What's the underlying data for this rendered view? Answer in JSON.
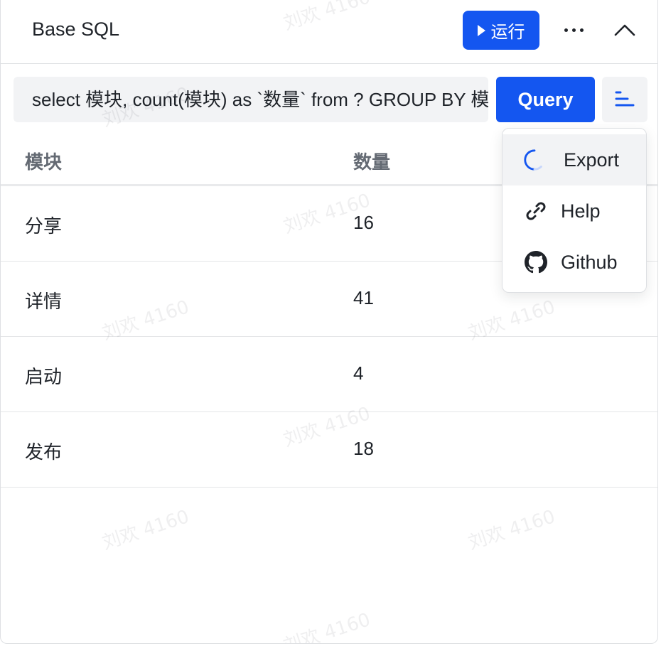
{
  "header": {
    "title": "Base SQL",
    "run_label": "运行"
  },
  "query": {
    "sql": "select 模块, count(模块) as `数量` from ? GROUP BY 模块",
    "query_label": "Query"
  },
  "table": {
    "columns": [
      "模块",
      "数量"
    ],
    "rows": [
      [
        "分享",
        "16"
      ],
      [
        "详情",
        "41"
      ],
      [
        "启动",
        "4"
      ],
      [
        "发布",
        "18"
      ]
    ]
  },
  "menu": {
    "items": [
      {
        "label": "Export",
        "icon": "loading-spinner-icon"
      },
      {
        "label": "Help",
        "icon": "link-icon"
      },
      {
        "label": "Github",
        "icon": "github-icon"
      }
    ]
  },
  "watermark": "刘欢 4160",
  "colors": {
    "primary": "#1456f0",
    "input_bg": "#f2f3f5",
    "border": "#dee0e3"
  }
}
